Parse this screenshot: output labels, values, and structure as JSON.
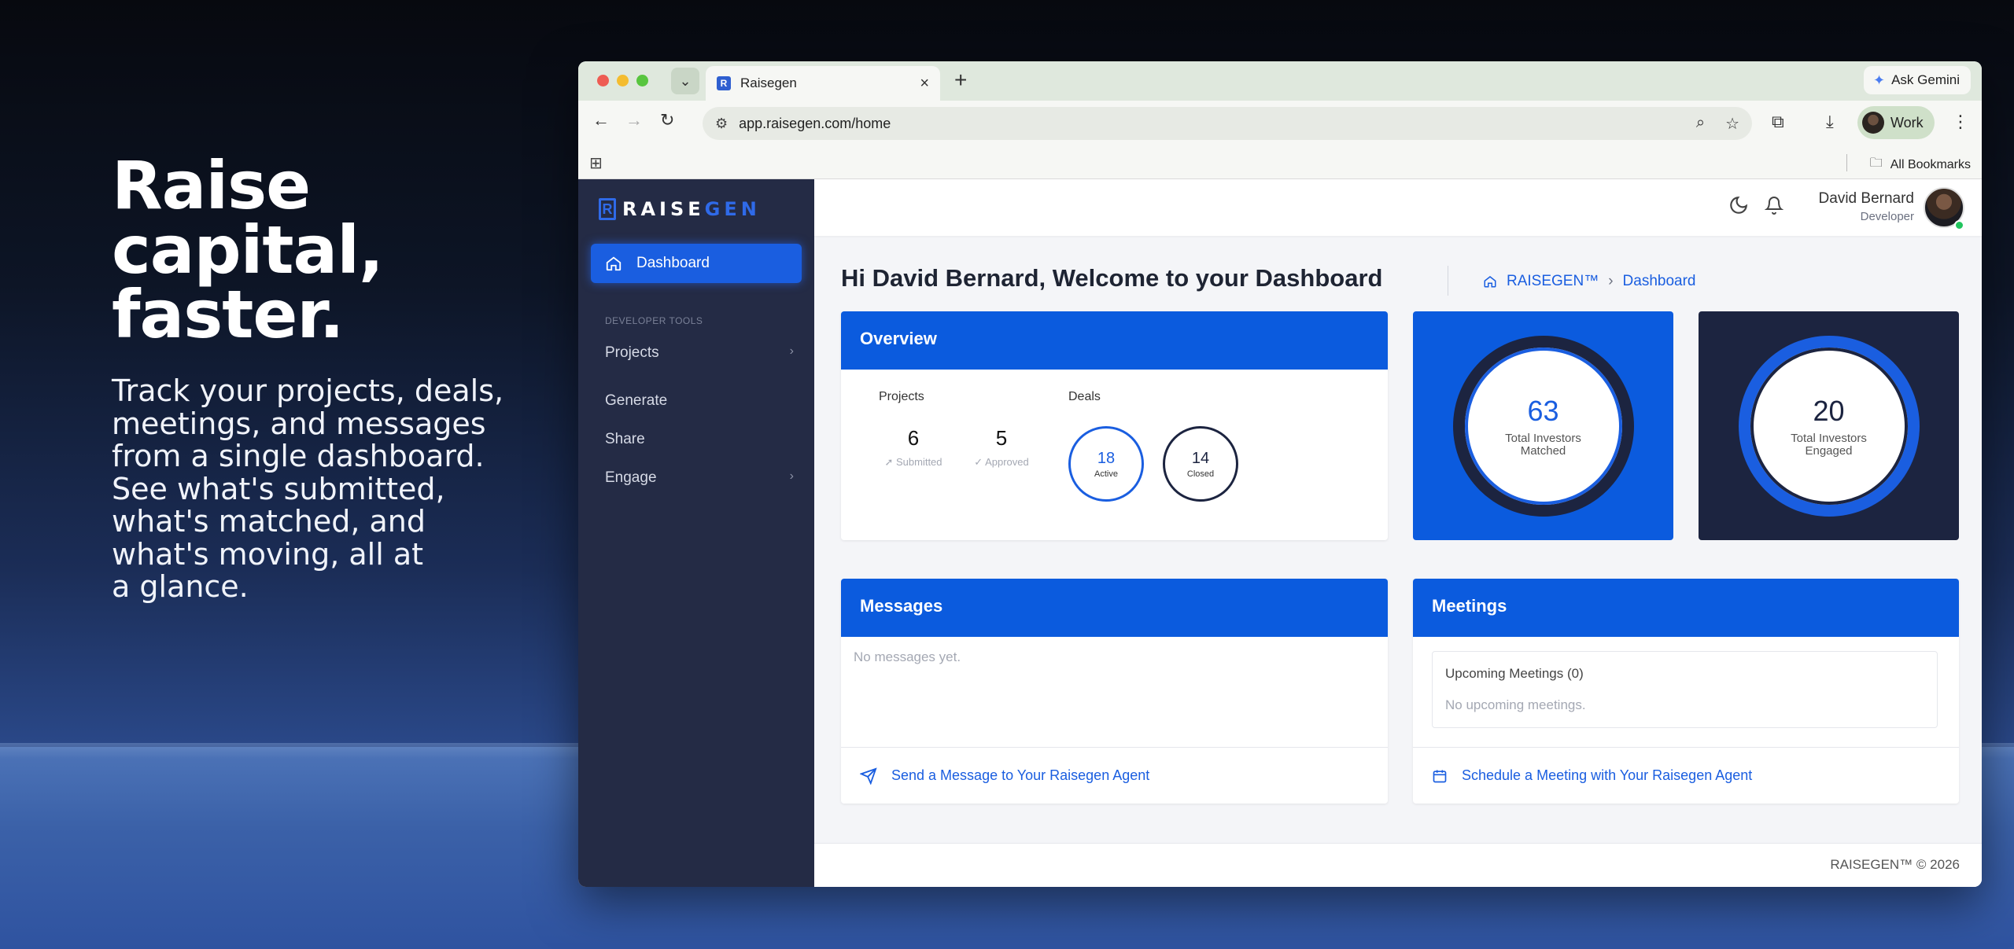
{
  "hero": {
    "title_lines": [
      "Raise",
      "capital,",
      "faster."
    ],
    "subtitle_lines": [
      "Track your projects, deals,",
      "meetings, and messages",
      "from a single dashboard.",
      "See what's submitted,",
      "what's matched, and",
      "what's moving, all at",
      "a glance."
    ]
  },
  "browser": {
    "tab_title": "Raisegen",
    "tab_favicon": "R",
    "gemini_label": "Ask Gemini",
    "url": "app.raisegen.com/home",
    "profile_label": "Work",
    "bookmarks_label": "All Bookmarks"
  },
  "sidebar": {
    "logo_prefix": "RAISE",
    "logo_accent": "GEN",
    "active_item": "Dashboard",
    "section_title": "DEVELOPER TOOLS",
    "items": [
      {
        "label": "Projects",
        "has_chevron": true
      },
      {
        "label": "Generate",
        "has_chevron": false
      },
      {
        "label": "Share",
        "has_chevron": false
      },
      {
        "label": "Engage",
        "has_chevron": true
      }
    ]
  },
  "topbar": {
    "user_name": "David Bernard",
    "user_role": "Developer"
  },
  "page": {
    "title": "Hi David Bernard, Welcome to your Dashboard",
    "breadcrumb": [
      "RAISEGEN™",
      "Dashboard"
    ]
  },
  "overview": {
    "title": "Overview",
    "projects_label": "Projects",
    "deals_label": "Deals",
    "submitted_count": "6",
    "submitted_label": "Submitted",
    "approved_count": "5",
    "approved_label": "Approved",
    "active_count": "18",
    "active_label": "Active",
    "closed_count": "14",
    "closed_label": "Closed"
  },
  "stats": {
    "matched_count": "63",
    "matched_label_1": "Total Investors",
    "matched_label_2": "Matched",
    "engaged_count": "20",
    "engaged_label_1": "Total Investors",
    "engaged_label_2": "Engaged"
  },
  "messages": {
    "title": "Messages",
    "empty": "No messages yet.",
    "action": "Send a Message to Your Raisegen Agent"
  },
  "meetings": {
    "title": "Meetings",
    "upcoming_title": "Upcoming Meetings (0)",
    "empty": "No upcoming meetings.",
    "action": "Schedule a Meeting with Your Raisegen Agent"
  },
  "footer": {
    "copyright": "RAISEGEN™ © 2026"
  },
  "colors": {
    "primary": "#0b5bde",
    "sidebar": "#242b45",
    "navy_card": "#1c2440"
  },
  "icons": [
    "home-icon",
    "bell-icon",
    "moon-icon",
    "send-icon",
    "calendar-icon",
    "chevron-right-icon"
  ]
}
